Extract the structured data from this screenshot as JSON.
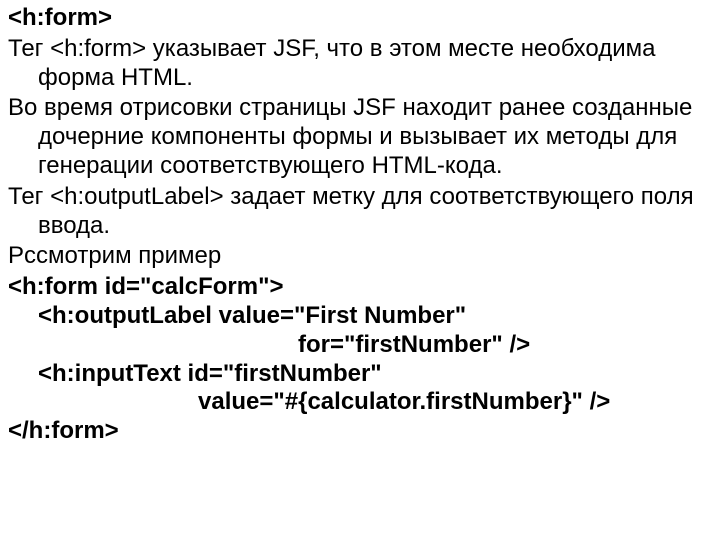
{
  "title": "<h:form>",
  "para1": "Тег <h:form> указывает JSF, что в этом месте необходима форма HTML.",
  "para2": "Во время отрисовки страницы JSF находит ранее созданные дочерние компоненты формы и вызывает их методы для генерации соответствующего HTML-кода.",
  "para3": "Тег <h:outputLabel> задает метку для соответствующего поля ввода.",
  "para4": "Рссмотрим пример",
  "code1": "<h:form id=\"calcForm\">",
  "code2": "<h:outputLabel value=\"First Number\"",
  "code3": "for=\"firstNumber\" />",
  "code4": "<h:inputText id=\"firstNumber\"",
  "code5": "value=\"#{calculator.firstNumber}\" />",
  "code6": "</h:form>"
}
